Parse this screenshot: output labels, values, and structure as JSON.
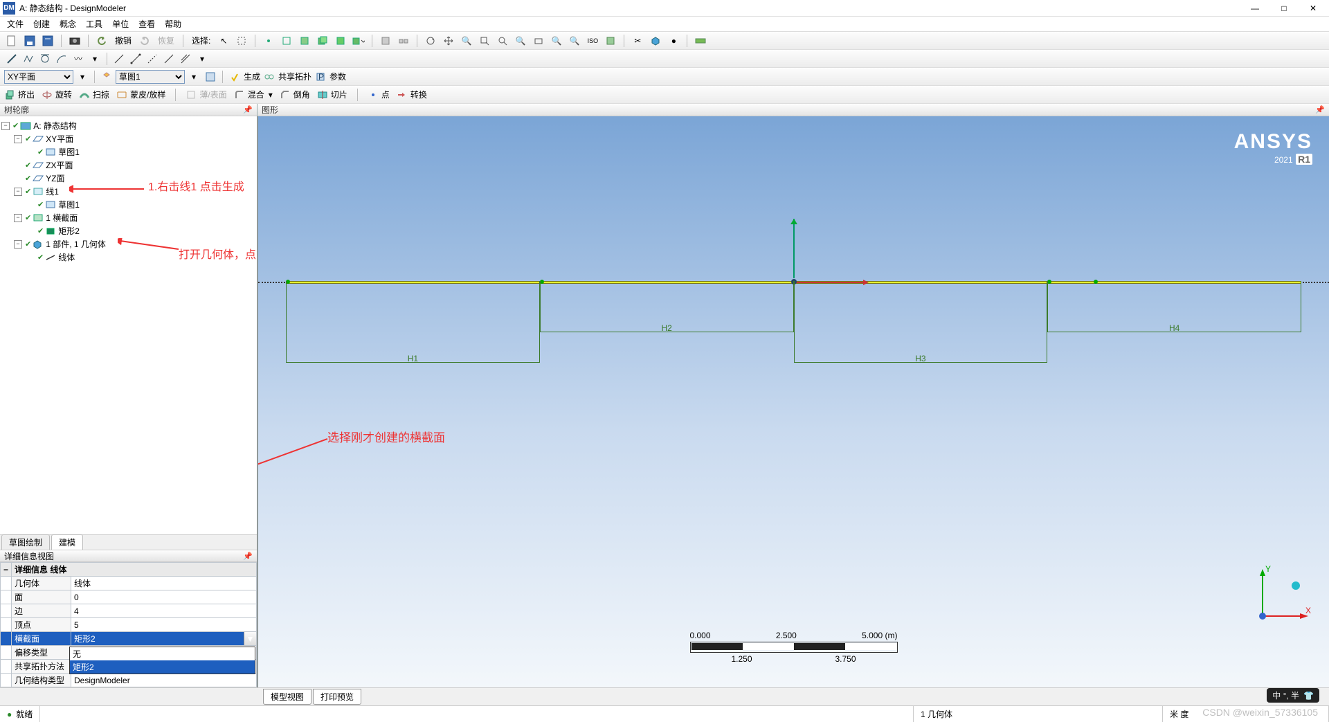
{
  "title": "A: 静态结构 - DesignModeler",
  "window_controls": {
    "min": "—",
    "max": "□",
    "close": "✕"
  },
  "menu": [
    "文件",
    "创建",
    "概念",
    "工具",
    "单位",
    "查看",
    "帮助"
  ],
  "toolbar1": {
    "undo": "撤销",
    "redo": "恢复",
    "select_label": "选择:"
  },
  "toolbar2": {
    "plane_dd": "XY平面",
    "sketch_dd": "草图1",
    "generate": "生成",
    "share_topo": "共享拓扑",
    "params": "参数"
  },
  "toolbar3": {
    "extrude": "挤出",
    "revolve": "旋转",
    "sweep": "扫掠",
    "skin": "蒙皮/放样",
    "thin": "薄/表面",
    "blend": "混合",
    "chamfer": "倒角",
    "slice": "切片",
    "point": "点",
    "convert": "转换"
  },
  "tree_panel_title": "树轮廓",
  "graphics_panel_title": "图形",
  "tree": {
    "root": "A: 静态结构",
    "xy_plane": "XY平面",
    "sketch1a": "草图1",
    "zx_plane": "ZX平面",
    "yz_plane": "YZ面",
    "line1": "线1",
    "sketch1b": "草图1",
    "cross_section_group": "1 横截面",
    "rect2": "矩形2",
    "parts": "1 部件, 1 几何体",
    "line_body": "线体"
  },
  "annotations": {
    "a1": "1.右击线1  点击生成",
    "a2": "打开几何体，点击下方线体",
    "a3": "选择刚才创建的横截面"
  },
  "left_tabs": {
    "sketch": "草图绘制",
    "model": "建模"
  },
  "details_panel_title": "详细信息视图",
  "details": {
    "header": "详细信息 线体",
    "rows": {
      "geom_k": "几何体",
      "geom_v": "线体",
      "face_k": "面",
      "face_v": "0",
      "edge_k": "边",
      "edge_v": "4",
      "vert_k": "顶点",
      "vert_v": "5",
      "cs_k": "横截面",
      "cs_v": "矩形2",
      "offset_k": "偏移类型",
      "offset_v": "无",
      "share_k": "共享拓扑方法",
      "geotype_k": "几何结构类型",
      "geotype_v": "DesignModeler"
    },
    "dropdown_opts": [
      "无",
      "矩形2"
    ]
  },
  "viewport": {
    "brand1": "ANSYS",
    "brand2_a": "2021",
    "brand2_b": "R1",
    "dims": {
      "h1": "H1",
      "h2": "H2",
      "h3": "H3",
      "h4": "H4"
    },
    "scale": {
      "s0": "0.000",
      "s1": "1.250",
      "s2": "2.500",
      "s3": "3.750",
      "s4": "5.000 (m)"
    },
    "axes": {
      "x": "X",
      "y": "Y"
    }
  },
  "view_tabs": {
    "model": "模型视图",
    "print": "打印预览"
  },
  "status": {
    "ready_icon": "●",
    "ready": "就绪",
    "sel": "1 几何体",
    "units": "米  度",
    "ime": "中 °, 半",
    "watermark": "CSDN @weixin_57336105"
  }
}
